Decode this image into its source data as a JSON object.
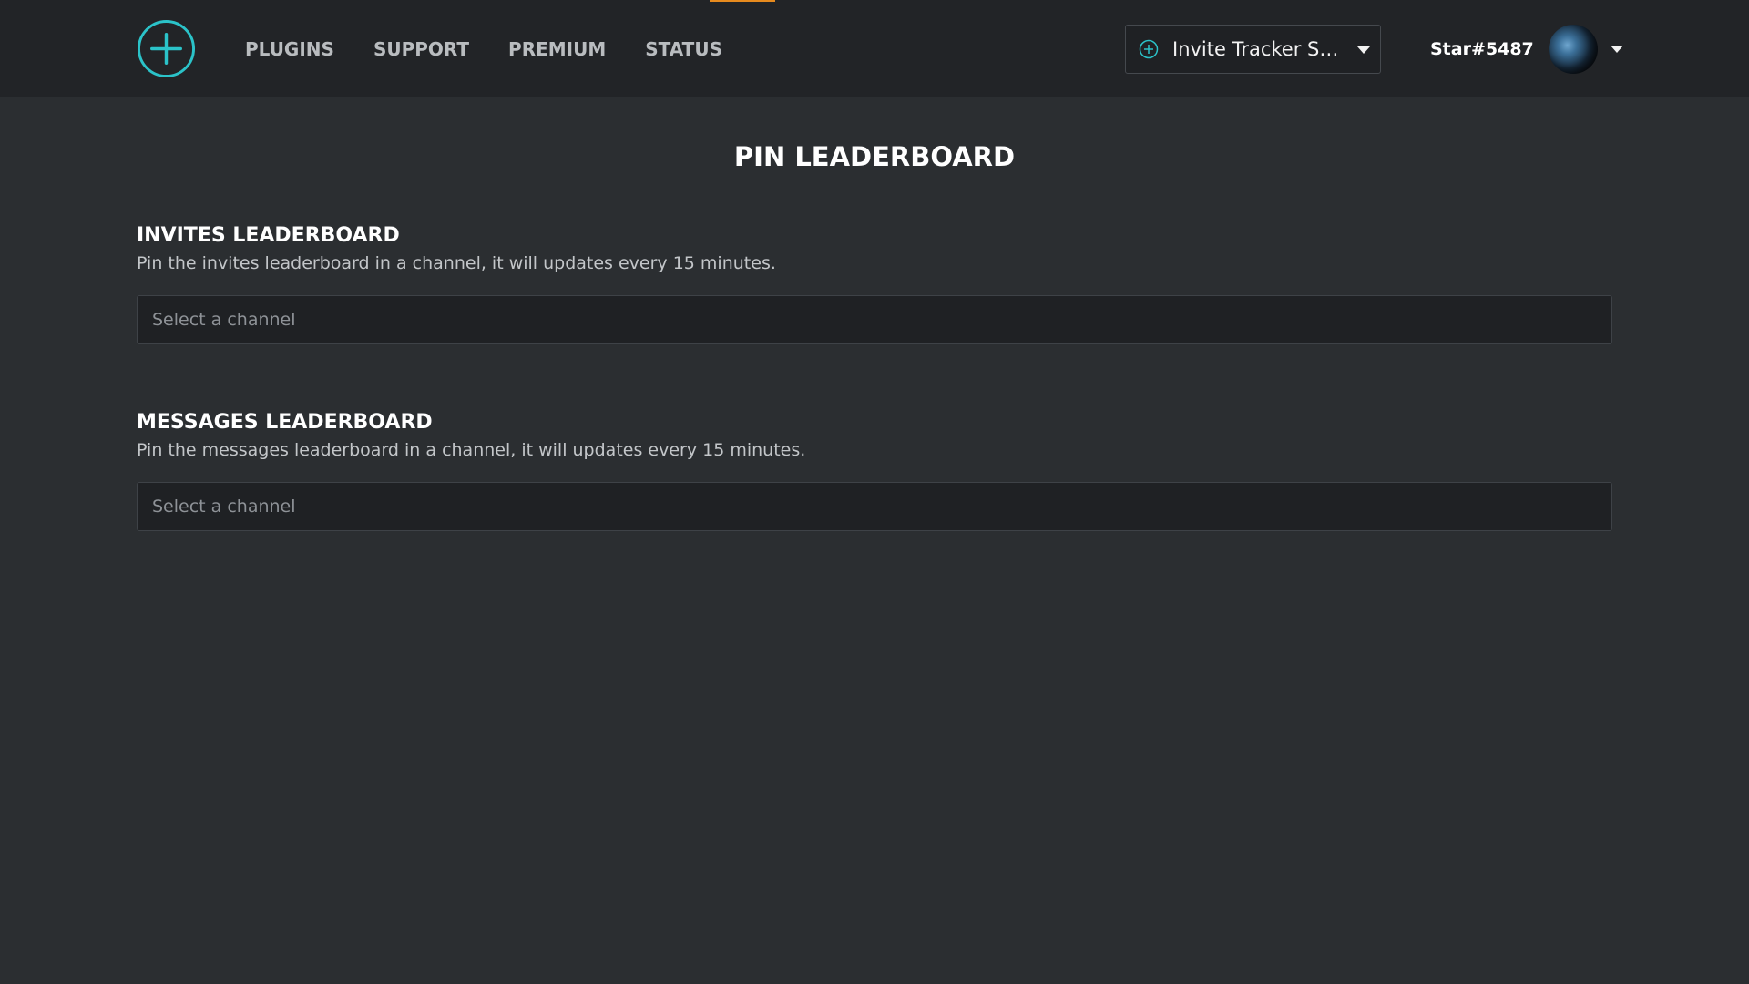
{
  "colors": {
    "accent": "#2bc3c9",
    "active_line": "#e68a1e",
    "background": "#2b2e31",
    "topbar": "#222427"
  },
  "nav": {
    "logo_icon": "plus-circle-icon",
    "items": [
      {
        "label": "PLUGINS"
      },
      {
        "label": "SUPPORT"
      },
      {
        "label": "PREMIUM"
      },
      {
        "label": "STATUS"
      }
    ]
  },
  "server_select": {
    "icon": "plus-circle-icon",
    "value": "Invite Tracker Su..."
  },
  "user": {
    "username": "Star#5487"
  },
  "page": {
    "title": "PIN LEADERBOARD"
  },
  "sections": [
    {
      "heading": "INVITES LEADERBOARD",
      "description": "Pin the invites leaderboard in a channel, it will updates every 15 minutes.",
      "placeholder": "Select a channel"
    },
    {
      "heading": "MESSAGES LEADERBOARD",
      "description": "Pin the messages leaderboard in a channel, it will updates every 15 minutes.",
      "placeholder": "Select a channel"
    }
  ]
}
